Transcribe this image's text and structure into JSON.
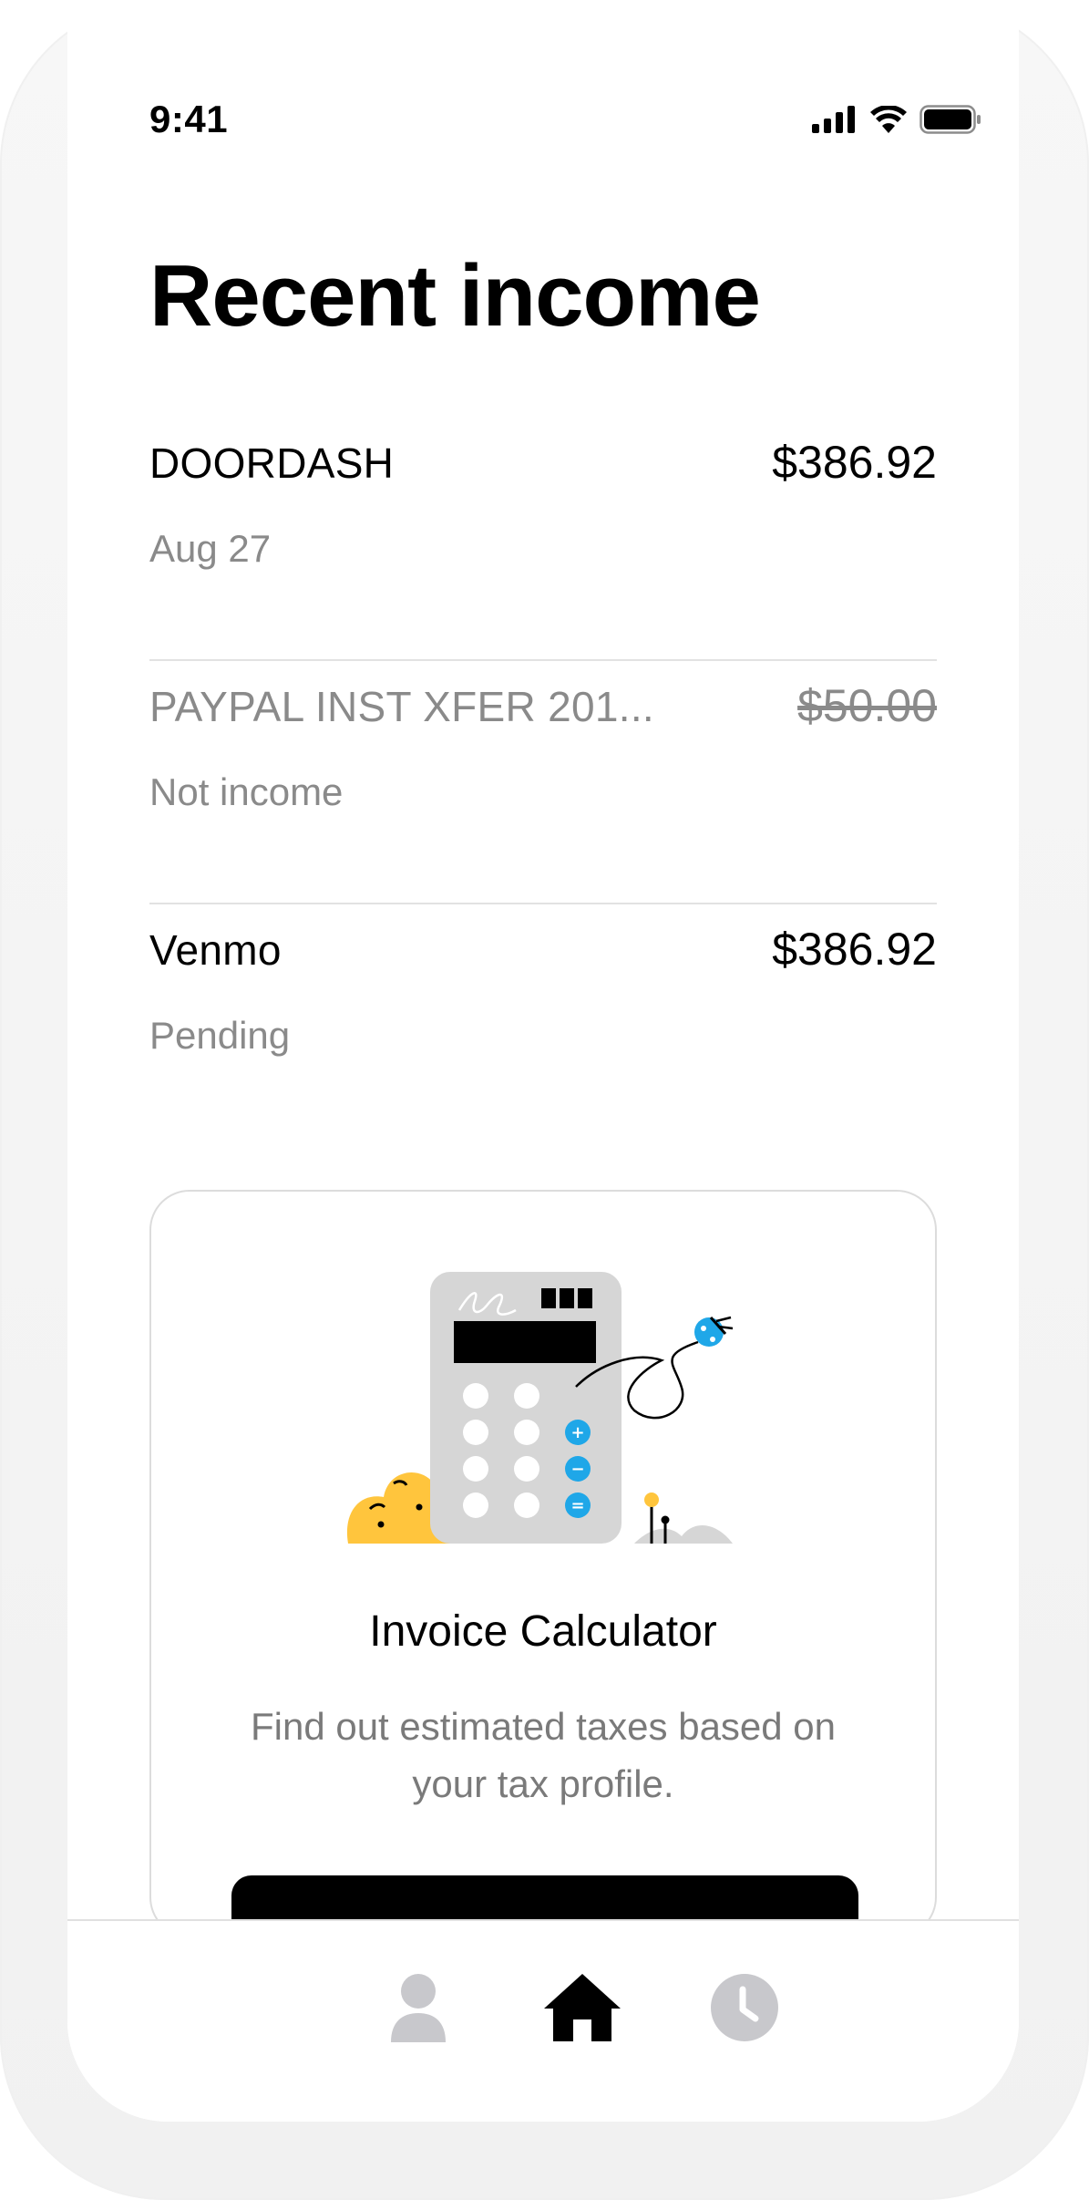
{
  "status_bar": {
    "time": "9:41",
    "icons": [
      "signal-icon",
      "wifi-icon",
      "battery-icon"
    ]
  },
  "page": {
    "title": "Recent income"
  },
  "income": [
    {
      "name": "DOORDASH",
      "amount": "$386.92",
      "sub": "Aug 27",
      "muted": false
    },
    {
      "name": "PAYPAL INST XFER 201...",
      "amount": "$50.00",
      "sub": "Not income",
      "muted": true
    },
    {
      "name": "Venmo",
      "amount": "$386.92",
      "sub": "Pending",
      "muted": false
    }
  ],
  "card": {
    "title": "Invoice Calculator",
    "description": "Find out estimated taxes based on your tax profile.",
    "illustration": "calculator-illustration",
    "calculator_keys": [
      "+",
      "−",
      "="
    ]
  },
  "bottom_nav": {
    "items": [
      {
        "icon": "person-icon",
        "active": false
      },
      {
        "icon": "home-icon",
        "active": true
      },
      {
        "icon": "clock-icon",
        "active": false
      }
    ]
  },
  "colors": {
    "accent_blue": "#1fa7e8",
    "accent_yellow": "#ffc53d",
    "muted_text": "#8a8a8a",
    "inactive_icon": "#c8c8cc"
  }
}
